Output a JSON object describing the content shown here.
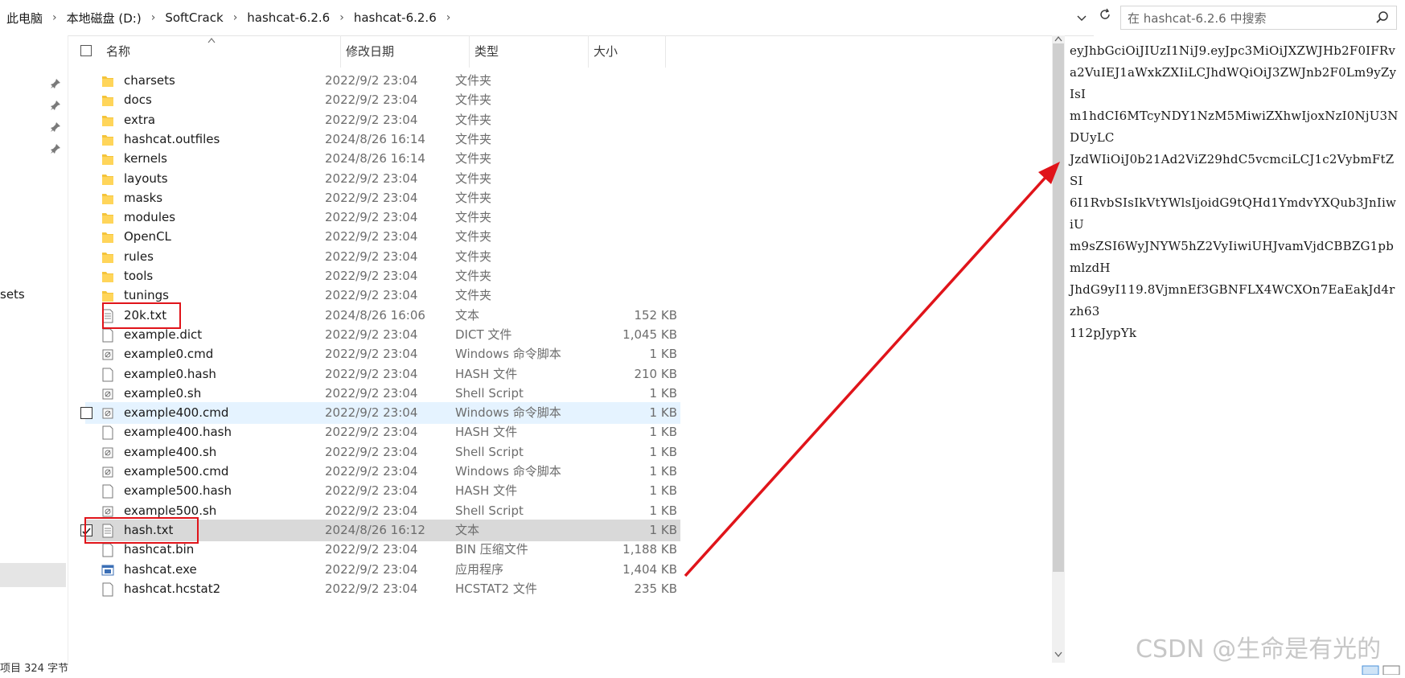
{
  "breadcrumb": [
    "此电脑",
    "本地磁盘 (D:)",
    "SoftCrack",
    "hashcat-6.2.6",
    "hashcat-6.2.6"
  ],
  "search": {
    "placeholder": "在 hashcat-6.2.6 中搜索"
  },
  "nav": {
    "partial_item": "sets"
  },
  "columns": {
    "name": "名称",
    "date": "修改日期",
    "type": "类型",
    "size": "大小"
  },
  "files": [
    {
      "name": "charsets",
      "date": "2022/9/2 23:04",
      "type": "文件夹",
      "size": "",
      "icon": "folder"
    },
    {
      "name": "docs",
      "date": "2022/9/2 23:04",
      "type": "文件夹",
      "size": "",
      "icon": "folder"
    },
    {
      "name": "extra",
      "date": "2022/9/2 23:04",
      "type": "文件夹",
      "size": "",
      "icon": "folder"
    },
    {
      "name": "hashcat.outfiles",
      "date": "2024/8/26 16:14",
      "type": "文件夹",
      "size": "",
      "icon": "folder"
    },
    {
      "name": "kernels",
      "date": "2024/8/26 16:14",
      "type": "文件夹",
      "size": "",
      "icon": "folder"
    },
    {
      "name": "layouts",
      "date": "2022/9/2 23:04",
      "type": "文件夹",
      "size": "",
      "icon": "folder"
    },
    {
      "name": "masks",
      "date": "2022/9/2 23:04",
      "type": "文件夹",
      "size": "",
      "icon": "folder"
    },
    {
      "name": "modules",
      "date": "2022/9/2 23:04",
      "type": "文件夹",
      "size": "",
      "icon": "folder"
    },
    {
      "name": "OpenCL",
      "date": "2022/9/2 23:04",
      "type": "文件夹",
      "size": "",
      "icon": "folder"
    },
    {
      "name": "rules",
      "date": "2022/9/2 23:04",
      "type": "文件夹",
      "size": "",
      "icon": "folder"
    },
    {
      "name": "tools",
      "date": "2022/9/2 23:04",
      "type": "文件夹",
      "size": "",
      "icon": "folder"
    },
    {
      "name": "tunings",
      "date": "2022/9/2 23:04",
      "type": "文件夹",
      "size": "",
      "icon": "folder"
    },
    {
      "name": "20k.txt",
      "date": "2024/8/26 16:06",
      "type": "文本",
      "size": "152 KB",
      "icon": "text"
    },
    {
      "name": "example.dict",
      "date": "2022/9/2 23:04",
      "type": "DICT 文件",
      "size": "1,045 KB",
      "icon": "blank"
    },
    {
      "name": "example0.cmd",
      "date": "2022/9/2 23:04",
      "type": "Windows 命令脚本",
      "size": "1 KB",
      "icon": "script"
    },
    {
      "name": "example0.hash",
      "date": "2022/9/2 23:04",
      "type": "HASH 文件",
      "size": "210 KB",
      "icon": "blank"
    },
    {
      "name": "example0.sh",
      "date": "2022/9/2 23:04",
      "type": "Shell Script",
      "size": "1 KB",
      "icon": "script"
    },
    {
      "name": "example400.cmd",
      "date": "2022/9/2 23:04",
      "type": "Windows 命令脚本",
      "size": "1 KB",
      "icon": "script"
    },
    {
      "name": "example400.hash",
      "date": "2022/9/2 23:04",
      "type": "HASH 文件",
      "size": "1 KB",
      "icon": "blank"
    },
    {
      "name": "example400.sh",
      "date": "2022/9/2 23:04",
      "type": "Shell Script",
      "size": "1 KB",
      "icon": "script"
    },
    {
      "name": "example500.cmd",
      "date": "2022/9/2 23:04",
      "type": "Windows 命令脚本",
      "size": "1 KB",
      "icon": "script"
    },
    {
      "name": "example500.hash",
      "date": "2022/9/2 23:04",
      "type": "HASH 文件",
      "size": "1 KB",
      "icon": "blank"
    },
    {
      "name": "example500.sh",
      "date": "2022/9/2 23:04",
      "type": "Shell Script",
      "size": "1 KB",
      "icon": "script"
    },
    {
      "name": "hash.txt",
      "date": "2024/8/26 16:12",
      "type": "文本",
      "size": "1 KB",
      "icon": "text"
    },
    {
      "name": "hashcat.bin",
      "date": "2022/9/2 23:04",
      "type": "BIN 压缩文件",
      "size": "1,188 KB",
      "icon": "blank"
    },
    {
      "name": "hashcat.exe",
      "date": "2022/9/2 23:04",
      "type": "应用程序",
      "size": "1,404 KB",
      "icon": "exe"
    },
    {
      "name": "hashcat.hcstat2",
      "date": "2022/9/2 23:04",
      "type": "HCSTAT2 文件",
      "size": "235 KB",
      "icon": "blank"
    }
  ],
  "preview_lines": [
    "eyJhbGciOiJIUzI1NiJ9.eyJpc3MiOiJXZWJHb2F0IFRv",
    "a2VuIEJ1aWxkZXIiLCJhdWQiOiJ3ZWJnb2F0Lm9yZyIsI",
    "m1hdCI6MTcyNDY1NzM5MiwiZXhwIjoxNzI0NjU3NDUyLC",
    "JzdWIiOiJ0b21Ad2ViZ29hdC5vcmciLCJ1c2VybmFtZSI",
    "6I1RvbSIsIkVtYWlsIjoidG9tQHd1YmdvYXQub3JnIiwiU",
    "m9sZSI6WyJNYW5hZ2VyIiwiUHJvamVjdCBBZG1pbmlzdH",
    "JhdG9yI119.8VjmnEf3GBNFLX4WCXOn7EaEakJd4rzh63",
    "112pJypYk"
  ],
  "status": {
    "text": "项目 324 字节"
  },
  "watermark": "CSDN @生命是有光的"
}
